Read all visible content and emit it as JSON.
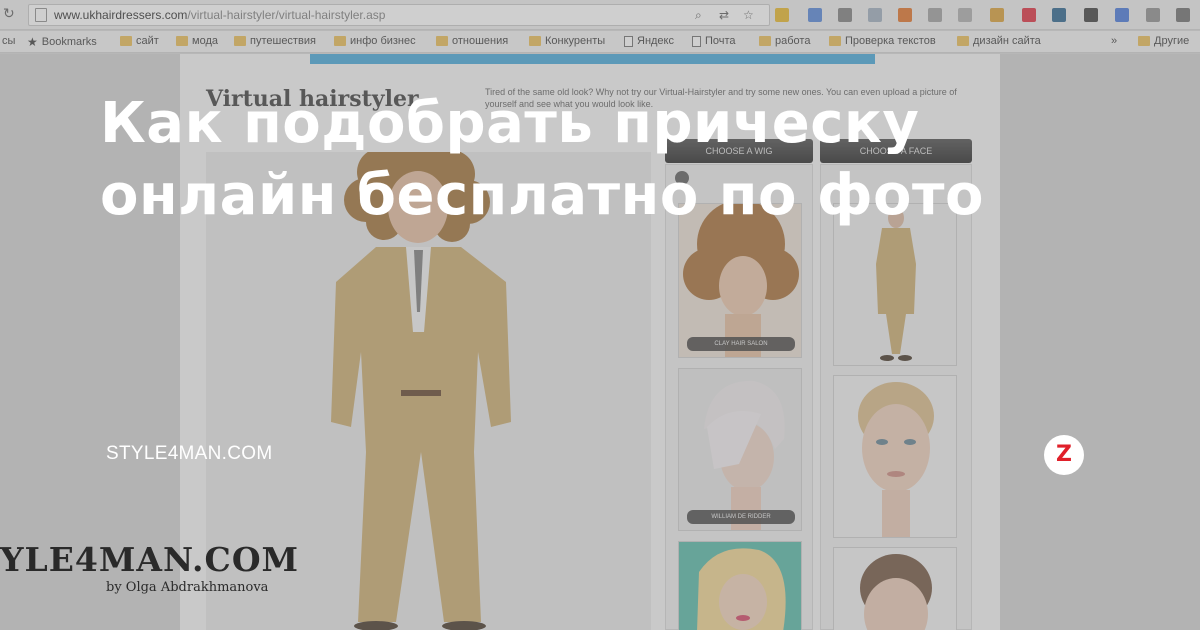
{
  "browser": {
    "url_host": "www.ukhairdressers.com",
    "url_path": "/virtual-hairstyler/virtual-hairstyler.asp"
  },
  "bookmarks": [
    {
      "label": "сы",
      "icon": "none"
    },
    {
      "label": "Bookmarks",
      "icon": "star-icon"
    },
    {
      "label": "сайт",
      "icon": "folder-icon"
    },
    {
      "label": "мода",
      "icon": "folder-icon"
    },
    {
      "label": "путешествия",
      "icon": "folder-icon"
    },
    {
      "label": "инфо бизнес",
      "icon": "folder-icon"
    },
    {
      "label": "отношения",
      "icon": "folder-icon"
    },
    {
      "label": "Конкуренты",
      "icon": "folder-icon"
    },
    {
      "label": "Яндекс",
      "icon": "doc-icon"
    },
    {
      "label": "Почта",
      "icon": "mail-icon"
    },
    {
      "label": "работа",
      "icon": "folder-icon"
    },
    {
      "label": "Проверка текстов",
      "icon": "folder-icon"
    },
    {
      "label": "дизайн сайта",
      "icon": "folder-icon"
    },
    {
      "label": "»",
      "icon": "none"
    },
    {
      "label": "Другие",
      "icon": "folder-icon"
    }
  ],
  "site": {
    "heading": "Virtual hairstyler",
    "intro": "Tired of the same old look? Why not try our Virtual-Hairstyler and try some new ones. You can even upload a picture of yourself and see what you would look like.",
    "choose_wig_label": "CHOOSE A WIG",
    "choose_face_label": "CHOOSE A FACE",
    "wig_labels": [
      "CLAY HAIR SALON",
      "WILLIAM DE RIDDER"
    ]
  },
  "overlay": {
    "headline": "Как подобрать прическу онлайн бесплатно по фото",
    "site_name": "STYLE4MAN.COM",
    "logo_letter": "Z",
    "watermark": "YLE4MAN.COM",
    "watermark_byline": "by Olga Abdrakhmanova"
  },
  "colors": {
    "accent_blue": "#3aa3d8",
    "logo_red": "#e0202a",
    "suit": "#c9a867"
  }
}
